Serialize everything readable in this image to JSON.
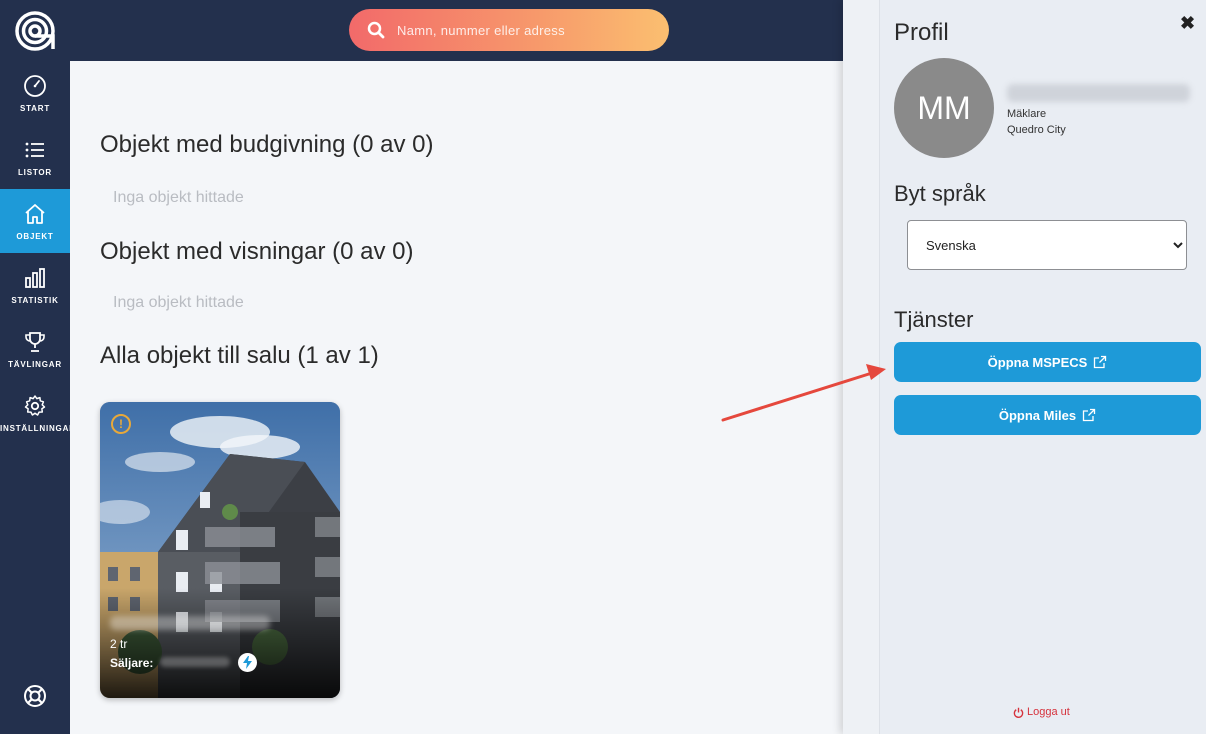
{
  "search": {
    "placeholder": "Namn, nummer eller adress"
  },
  "sidebar": {
    "items": [
      {
        "label": "START",
        "icon": "speedometer-icon"
      },
      {
        "label": "LISTOR",
        "icon": "list-icon"
      },
      {
        "label": "OBJEKT",
        "icon": "home-icon"
      },
      {
        "label": "STATISTIK",
        "icon": "bar-chart-icon"
      },
      {
        "label": "TÄVLINGAR",
        "icon": "trophy-icon"
      },
      {
        "label": "INSTÄLLNINGAR",
        "icon": "gear-icon"
      }
    ],
    "active_index": 2
  },
  "main": {
    "section1_title": "Objekt med budgivning (0 av 0)",
    "section1_empty": "Inga objekt hittade",
    "section2_title": "Objekt med visningar (0 av 0)",
    "section2_empty": "Inga objekt hittade",
    "section3_title": "Alla objekt till salu (1 av 1)",
    "card": {
      "rooms": "2 tr",
      "seller_label": "Säljare:"
    }
  },
  "panel": {
    "title": "Profil",
    "avatar_initials": "MM",
    "role": "Mäklare",
    "office": "Quedro City",
    "language_title": "Byt språk",
    "language_selected": "Svenska",
    "services_title": "Tjänster",
    "service_buttons": [
      "Öppna MSPECS",
      "Öppna Miles"
    ],
    "logout": "Logga ut"
  },
  "colors": {
    "sidebar": "#23304d",
    "accent": "#1e9ad8",
    "logout": "#d6323c",
    "annotation_arrow": "#e5483d"
  }
}
